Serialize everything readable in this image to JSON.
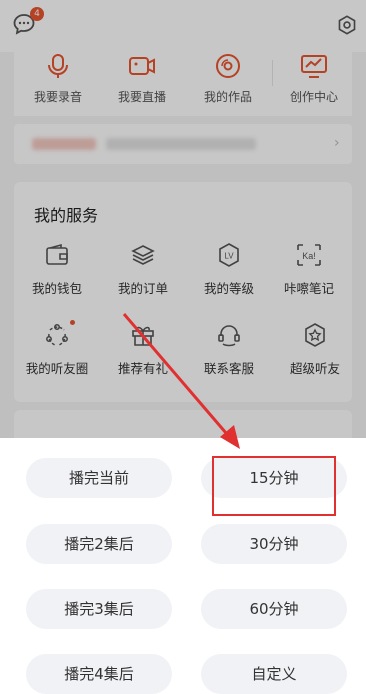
{
  "header": {
    "message_badge": "4"
  },
  "quick_actions": [
    {
      "label": "我要录音",
      "icon": "microphone-icon"
    },
    {
      "label": "我要直播",
      "icon": "video-camera-icon"
    },
    {
      "label": "我的作品",
      "icon": "disc-icon"
    },
    {
      "label": "创作中心",
      "icon": "monitor-chart-icon"
    }
  ],
  "services": {
    "title": "我的服务",
    "items": [
      {
        "label": "我的钱包",
        "icon": "wallet-icon"
      },
      {
        "label": "我的订单",
        "icon": "layers-icon"
      },
      {
        "label": "我的等级",
        "icon": "level-badge-icon",
        "glyph": "LV"
      },
      {
        "label": "咔嚓笔记",
        "icon": "note-icon",
        "glyph": "Ka!"
      },
      {
        "label": "我的听友圈",
        "icon": "friends-circle-icon"
      },
      {
        "label": "推荐有礼",
        "icon": "gift-icon"
      },
      {
        "label": "联系客服",
        "icon": "headset-icon"
      },
      {
        "label": "超级听友",
        "icon": "super-star-icon"
      }
    ]
  },
  "timer_options": {
    "left": [
      "播完当前",
      "播完2集后",
      "播完3集后",
      "播完4集后"
    ],
    "right": [
      "15分钟",
      "30分钟",
      "60分钟",
      "自定义"
    ]
  },
  "colors": {
    "accent": "#e8552f",
    "highlight": "#e03030",
    "pill_bg": "#f1f2f6"
  }
}
